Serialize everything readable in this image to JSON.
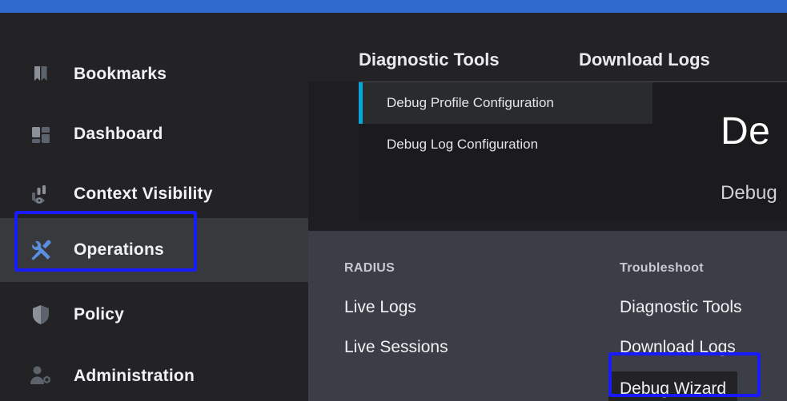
{
  "topbar": {
    "color": "#3069ce"
  },
  "sidebar": {
    "items": [
      {
        "label": "Bookmarks",
        "icon": "bookmarks-icon",
        "active": false
      },
      {
        "label": "Dashboard",
        "icon": "dashboard-grid-icon",
        "active": false
      },
      {
        "label": "Context Visibility",
        "icon": "context-visibility-icon",
        "active": false
      },
      {
        "label": "Operations",
        "icon": "tools-wrench-icon",
        "active": true
      },
      {
        "label": "Policy",
        "icon": "shield-icon",
        "active": false
      },
      {
        "label": "Administration",
        "icon": "user-gear-icon",
        "active": false
      }
    ]
  },
  "content": {
    "tabs": [
      {
        "label": "Diagnostic Tools"
      },
      {
        "label": "Download Logs"
      }
    ],
    "subnav": [
      {
        "label": "Debug Profile Configuration",
        "selected": true
      },
      {
        "label": "Debug Log Configuration",
        "selected": false
      }
    ],
    "panel": {
      "title": "De",
      "subtitle": "Debug"
    }
  },
  "flyout": {
    "columns": [
      {
        "heading": "RADIUS",
        "links": [
          {
            "label": "Live Logs",
            "highlighted": false
          },
          {
            "label": "Live Sessions",
            "highlighted": false
          }
        ]
      },
      {
        "heading": "Troubleshoot",
        "links": [
          {
            "label": "Diagnostic Tools",
            "highlighted": false
          },
          {
            "label": "Download Logs",
            "highlighted": false
          },
          {
            "label": "Debug Wizard",
            "highlighted": true
          }
        ]
      }
    ]
  },
  "highlights": {
    "accent_color": "#1a1aff",
    "boxes": [
      {
        "target": "Operations"
      },
      {
        "target": "Debug Wizard"
      }
    ]
  }
}
